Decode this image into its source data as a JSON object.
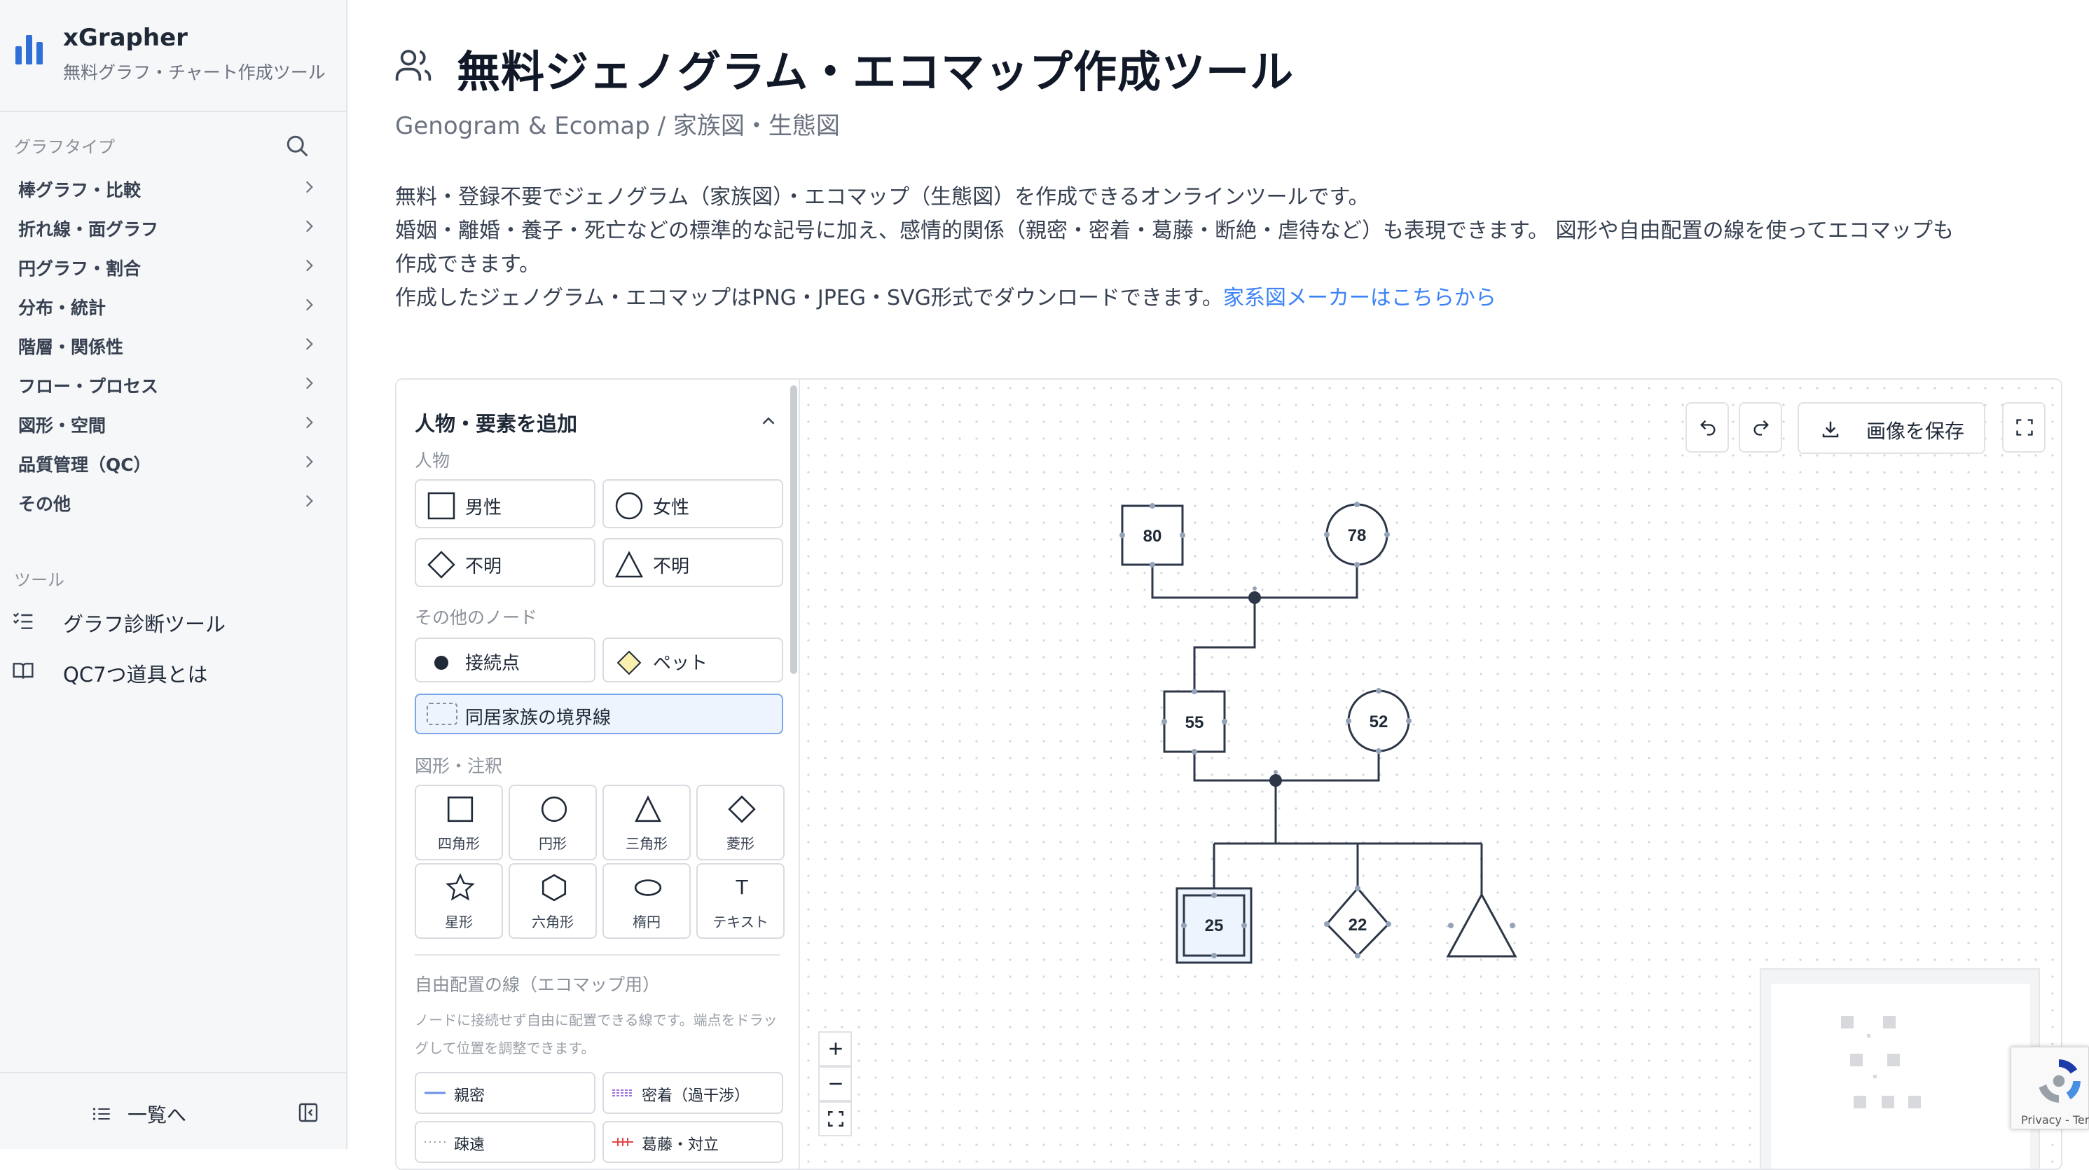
{
  "brand": {
    "name": "xGrapher",
    "subtitle": "無料グラフ・チャート作成ツール"
  },
  "sidebar": {
    "section_graph_types": "グラフタイプ",
    "categories": [
      {
        "label": "棒グラフ・比較"
      },
      {
        "label": "折れ線・面グラフ"
      },
      {
        "label": "円グラフ・割合"
      },
      {
        "label": "分布・統計"
      },
      {
        "label": "階層・関係性"
      },
      {
        "label": "フロー・プロセス"
      },
      {
        "label": "図形・空間"
      },
      {
        "label": "品質管理（QC）"
      },
      {
        "label": "その他"
      }
    ],
    "section_tools": "ツール",
    "tools": [
      {
        "label": "グラフ診断ツール",
        "icon": "list-check-icon"
      },
      {
        "label": "QC7つ道具とは",
        "icon": "book-icon"
      }
    ],
    "footer_list_label": "一覧へ"
  },
  "page": {
    "title": "無料ジェノグラム・エコマップ作成ツール",
    "subtitle": "Genogram & Ecomap / 家族図・生態図",
    "desc_line1": "無料・登録不要でジェノグラム（家族図）・エコマップ（生態図）を作成できるオンラインツールです。",
    "desc_line2": "婚姻・離婚・養子・死亡などの標準的な記号に加え、感情的関係（親密・密着・葛藤・断絶・虐待など）も表現できます。 図形や自由配置の線を使ってエコマップも",
    "desc_line3": "作成できます。",
    "desc_line4": "作成したジェノグラム・エコマップはPNG・JPEG・SVG形式でダウンロードできます。",
    "desc_link": "家系図メーカーはこちらから"
  },
  "panel": {
    "header": "人物・要素を追加",
    "group_person": "人物",
    "persons": [
      {
        "label": "男性",
        "icon": "square-icon"
      },
      {
        "label": "女性",
        "icon": "circle-icon"
      },
      {
        "label": "不明",
        "icon": "diamond-icon"
      },
      {
        "label": "不明",
        "icon": "triangle-icon"
      }
    ],
    "group_other": "その他のノード",
    "others": [
      {
        "label": "接続点",
        "icon": "dot-icon"
      },
      {
        "label": "ペット",
        "icon": "pet-diamond-icon"
      }
    ],
    "household_label": "同居家族の境界線",
    "group_shapes": "図形・注釈",
    "shapes": [
      {
        "label": "四角形"
      },
      {
        "label": "円形"
      },
      {
        "label": "三角形"
      },
      {
        "label": "菱形"
      },
      {
        "label": "星形"
      },
      {
        "label": "六角形"
      },
      {
        "label": "楕円"
      },
      {
        "label": "テキスト"
      }
    ],
    "text_glyph": "T",
    "group_lines": "自由配置の線（エコマップ用）",
    "lines_hint_1": "ノードに接続せず自由に配置できる線です。端点をドラッ",
    "lines_hint_2": "グして位置を調整できます。",
    "lines": [
      {
        "label": "親密",
        "color": "#6b8fe8"
      },
      {
        "label": "密着（過干渉）",
        "color": "#9b6fe0"
      },
      {
        "label": "疎遠",
        "color": "#9aa0a8"
      },
      {
        "label": "葛藤・対立",
        "color": "#e04848"
      }
    ]
  },
  "toolbar": {
    "save_label": "画像を保存"
  },
  "nodes": [
    {
      "id": "n80",
      "label": "80",
      "kind": "male"
    },
    {
      "id": "n78",
      "label": "78",
      "kind": "female"
    },
    {
      "id": "n55",
      "label": "55",
      "kind": "male"
    },
    {
      "id": "n52",
      "label": "52",
      "kind": "female"
    },
    {
      "id": "n25",
      "label": "25",
      "kind": "male-selected"
    },
    {
      "id": "n22",
      "label": "22",
      "kind": "unknown-diamond"
    },
    {
      "id": "ntri",
      "label": "",
      "kind": "unknown-triangle"
    }
  ],
  "recaptcha": {
    "label": "Privacy - Terms"
  },
  "colors": {
    "accent": "#2f6fd8",
    "link": "#3b82f6",
    "node_stroke": "#2d3748",
    "handle": "#94a3b8",
    "selected_fill": "#eef4fd"
  }
}
